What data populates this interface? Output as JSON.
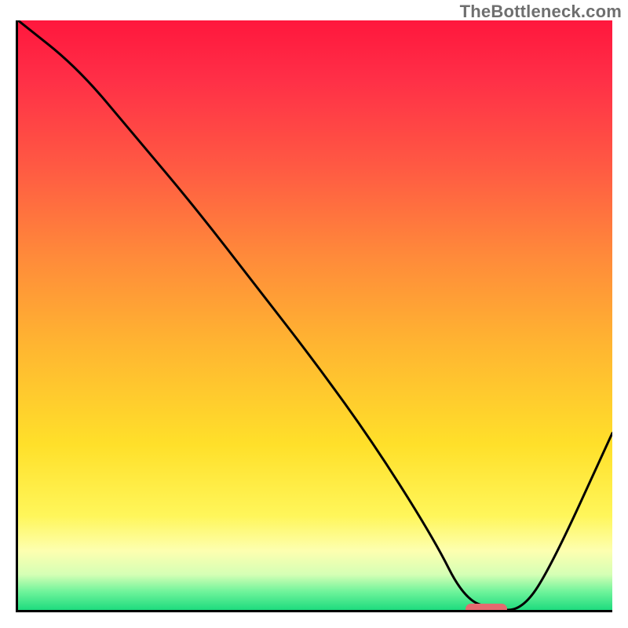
{
  "watermark": "TheBottleneck.com",
  "chart_data": {
    "type": "line",
    "title": "",
    "xlabel": "",
    "ylabel": "",
    "xlim": [
      0,
      100
    ],
    "ylim": [
      0,
      100
    ],
    "grid": false,
    "legend": false,
    "background_gradient": {
      "direction": "vertical",
      "stops": [
        {
          "pos": 0,
          "color": "#ff173d"
        },
        {
          "pos": 10,
          "color": "#ff2f47"
        },
        {
          "pos": 25,
          "color": "#ff5a43"
        },
        {
          "pos": 40,
          "color": "#ff8a3a"
        },
        {
          "pos": 55,
          "color": "#ffb531"
        },
        {
          "pos": 72,
          "color": "#ffe02a"
        },
        {
          "pos": 84,
          "color": "#fff65a"
        },
        {
          "pos": 90,
          "color": "#fdffb0"
        },
        {
          "pos": 94,
          "color": "#d5ffb5"
        },
        {
          "pos": 97,
          "color": "#6cf39a"
        },
        {
          "pos": 100,
          "color": "#1edb7e"
        }
      ]
    },
    "series": [
      {
        "name": "curve",
        "color": "#000000",
        "x": [
          0,
          10,
          20,
          30,
          40,
          50,
          60,
          70,
          75,
          80,
          85,
          90,
          100
        ],
        "y": [
          100,
          92,
          80,
          68,
          55,
          42,
          28,
          12,
          2,
          0,
          0,
          8,
          30
        ]
      }
    ],
    "marker": {
      "color": "#e46a6f",
      "shape": "pill",
      "x_range": [
        75,
        82
      ],
      "y": 0.5
    }
  }
}
